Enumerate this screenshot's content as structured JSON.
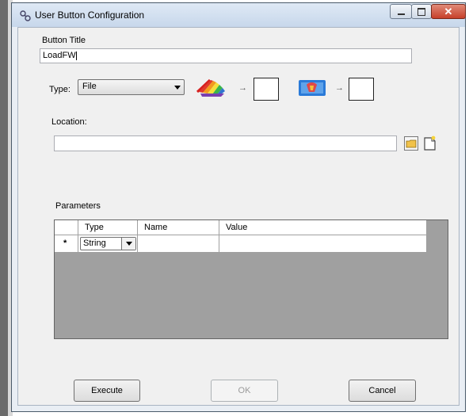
{
  "window": {
    "title": "User Button Configuration",
    "controls": {
      "minimize": "—",
      "maximize": "□",
      "close": "✕"
    }
  },
  "form": {
    "button_title_label": "Button Title",
    "button_title_value": "LoadFW",
    "type_label": "Type:",
    "type_value": "File",
    "location_label": "Location:",
    "location_value": "",
    "parameters_label": "Parameters",
    "arrow1": "→",
    "arrow2": "→"
  },
  "parameters_grid": {
    "columns": [
      "",
      "Type",
      "Name",
      "Value"
    ],
    "new_row_marker": "*",
    "new_row_type": "String",
    "new_row_name": "",
    "new_row_value": ""
  },
  "buttons": {
    "execute": "Execute",
    "ok": "OK",
    "cancel": "Cancel"
  },
  "icons": [
    "color-wheel-icon",
    "image-icon",
    "folder-icon",
    "new-file-icon"
  ]
}
